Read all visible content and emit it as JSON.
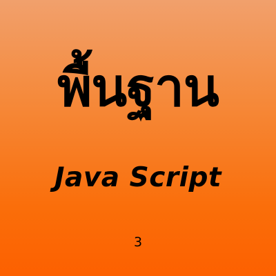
{
  "cover": {
    "title": "พื้นฐาน",
    "subtitle": "Java Script",
    "number": "3",
    "colors": {
      "gradient_top": "#f1a06c",
      "gradient_bottom": "#fd6000",
      "text": "#000000"
    }
  }
}
